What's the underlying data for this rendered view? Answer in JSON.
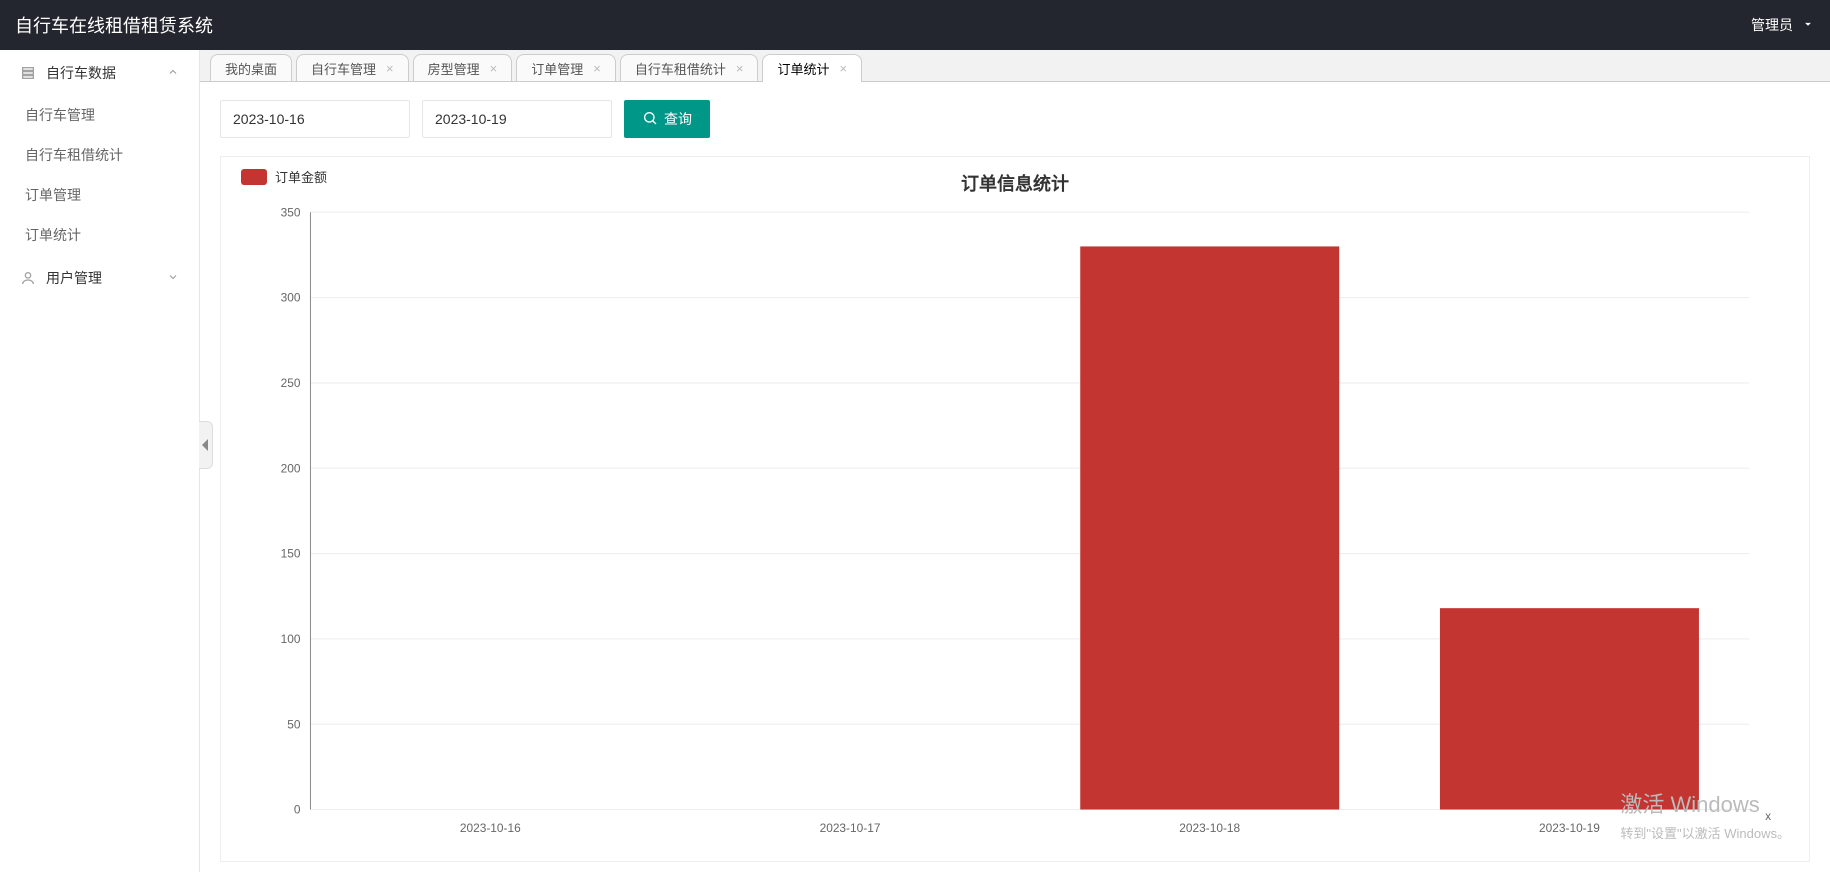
{
  "header": {
    "title": "自行车在线租借租赁系统",
    "user_label": "管理员"
  },
  "sidebar": {
    "groups": [
      {
        "label": "自行车数据",
        "expanded": true,
        "icon": "layers",
        "items": [
          {
            "label": "自行车管理"
          },
          {
            "label": "自行车租借统计"
          },
          {
            "label": "订单管理"
          },
          {
            "label": "订单统计"
          }
        ]
      },
      {
        "label": "用户管理",
        "expanded": false,
        "icon": "user",
        "items": []
      }
    ]
  },
  "tabs": {
    "items": [
      {
        "label": "我的桌面",
        "closable": false,
        "active": false
      },
      {
        "label": "自行车管理",
        "closable": true,
        "active": false
      },
      {
        "label": "房型管理",
        "closable": true,
        "active": false
      },
      {
        "label": "订单管理",
        "closable": true,
        "active": false
      },
      {
        "label": "自行车租借统计",
        "closable": true,
        "active": false
      },
      {
        "label": "订单统计",
        "closable": true,
        "active": true
      }
    ]
  },
  "controls": {
    "date_from": "2023-10-16",
    "date_to": "2023-10-19",
    "search_label": "查询"
  },
  "chart_data": {
    "type": "bar",
    "title": "订单信息统计",
    "legend": "订单金额",
    "categories": [
      "2023-10-16",
      "2023-10-17",
      "2023-10-18",
      "2023-10-19"
    ],
    "values": [
      0,
      0,
      330,
      118
    ],
    "ylim": [
      0,
      350
    ],
    "ytick_step": 50,
    "xlabel": "x",
    "color": "#c23531"
  },
  "watermark": {
    "line1": "激活 Windows",
    "line2": "转到\"设置\"以激活 Windows。"
  }
}
